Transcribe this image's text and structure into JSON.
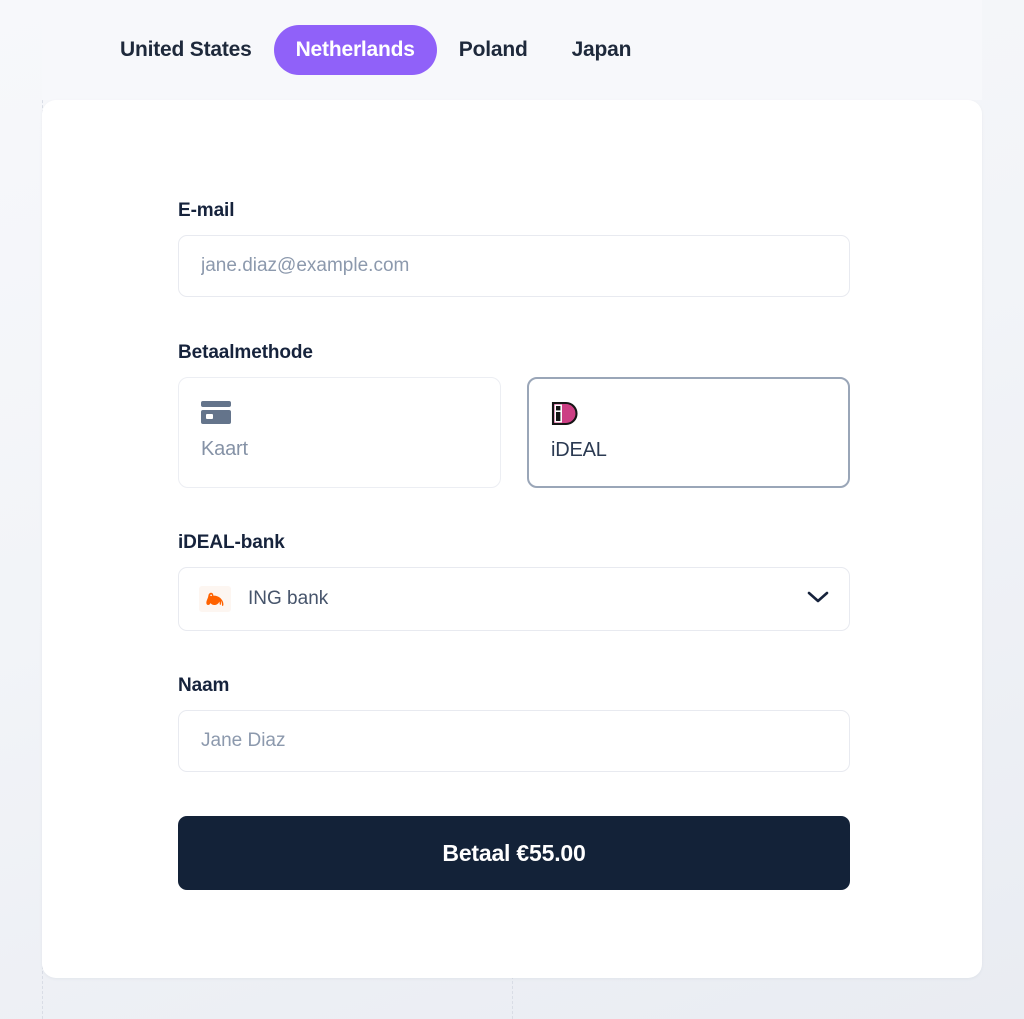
{
  "tabs": [
    {
      "label": "United States",
      "active": false
    },
    {
      "label": "Netherlands",
      "active": true
    },
    {
      "label": "Poland",
      "active": false
    },
    {
      "label": "Japan",
      "active": false
    }
  ],
  "form": {
    "email": {
      "label": "E-mail",
      "placeholder": "jane.diaz@example.com",
      "value": ""
    },
    "payment_method": {
      "label": "Betaalmethode",
      "options": [
        {
          "name": "Kaart",
          "icon": "credit-card-icon",
          "selected": false
        },
        {
          "name": "iDEAL",
          "icon": "ideal-logo-icon",
          "selected": true
        }
      ]
    },
    "bank": {
      "label": "iDEAL-bank",
      "selected": "ING bank",
      "logo": "ing-lion-icon",
      "chevron": "chevron-down-icon"
    },
    "name": {
      "label": "Naam",
      "placeholder": "Jane Diaz",
      "value": ""
    },
    "submit": {
      "label": "Betaal €55.00",
      "amount": "55.00",
      "currency": "€"
    }
  },
  "colors": {
    "accent": "#9061f9",
    "button": "#132238",
    "text_dark": "#16233c",
    "text_muted": "#8592a6",
    "ideal_pink": "#cc1e6c",
    "ing_orange": "#ff6200",
    "page_bg": "#f4f6fa"
  }
}
